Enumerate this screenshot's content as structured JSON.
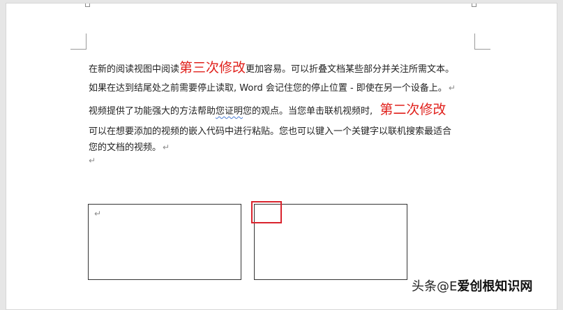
{
  "document": {
    "line1": {
      "before": "在新的阅读视图中阅读",
      "highlight": "第三次修改",
      "after": "更加容易。可以折叠文档某些部分并关注所需文本。"
    },
    "line2": {
      "text_a": "如果在达到结尾处之前需要停止读取,",
      "word_word": "Word",
      "text_b": "会记住您的停止位置 - 即使在另一个设备上。"
    },
    "line3": {
      "before": "视频提供了功能强大的方法帮助",
      "squiggle": "您证明",
      "after": "您的观点。当您单击联机视频时,",
      "highlight": "第二次修改"
    },
    "line4": "可以在想要添加的视频的嵌入代码中进行粘贴。您也可以键入一个关键字以联机搜索最适合",
    "line5": "您的文档的视频。",
    "paragraph_mark": "↵"
  },
  "watermark": {
    "part1": "头条",
    "part2": "@E",
    "part3": "爱创根知识网"
  },
  "colors": {
    "accent_red": "#e0201b",
    "highlight_box": "#d9232d"
  }
}
